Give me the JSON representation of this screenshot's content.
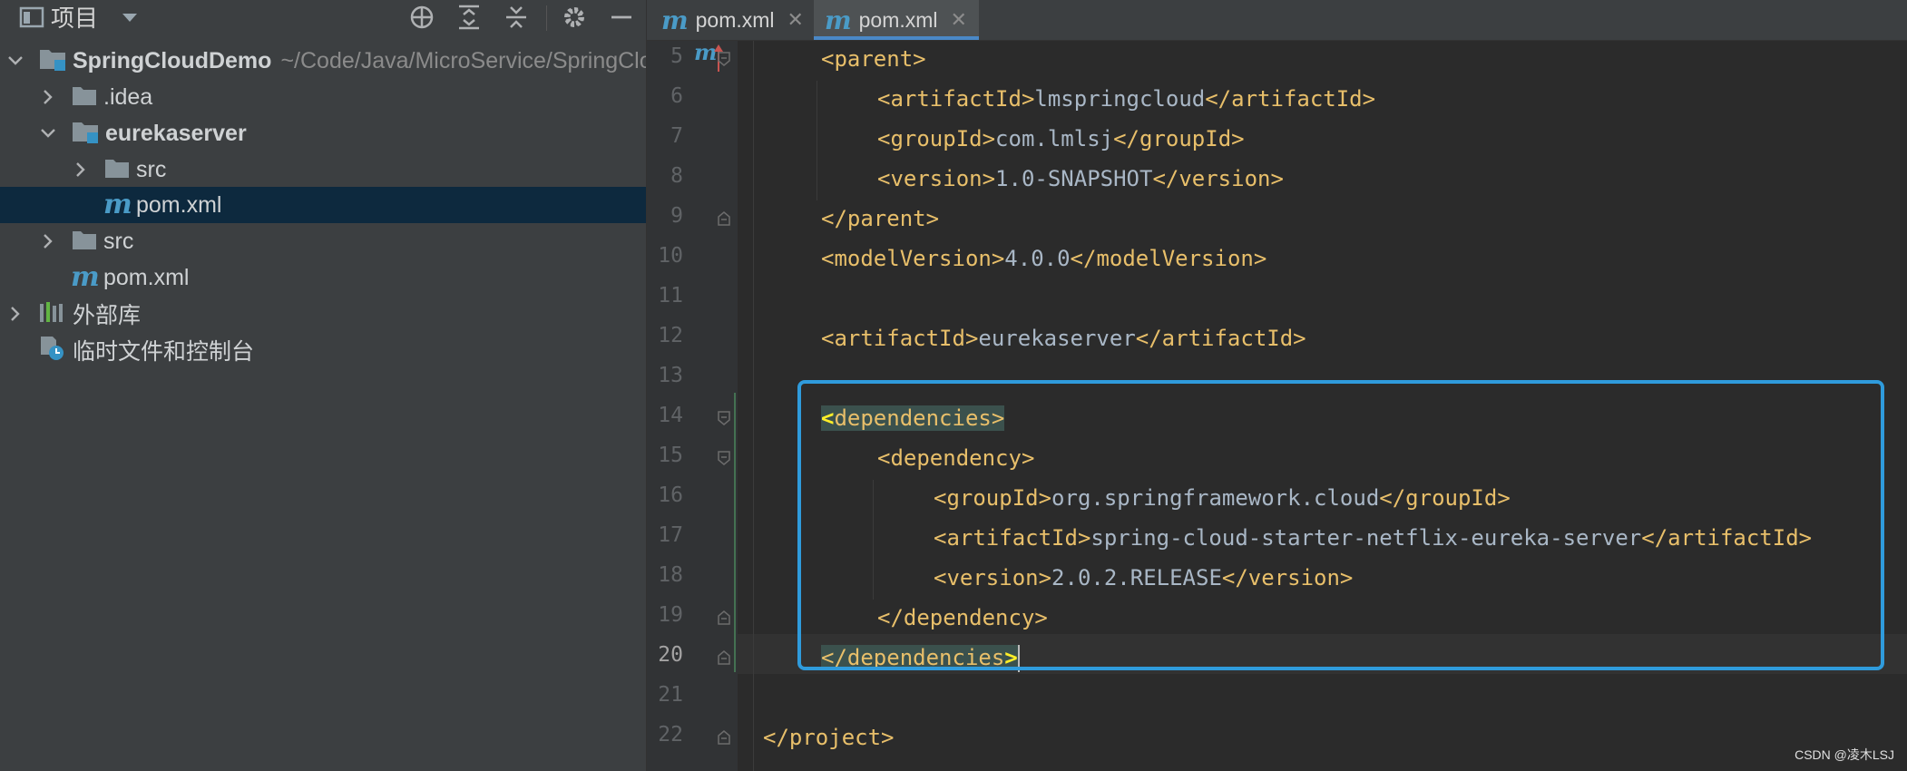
{
  "left_panel": {
    "title": "项目",
    "tree": [
      {
        "label": "SpringCloudDemo",
        "path": "~/Code/Java/MicroService/SpringCloudDemo"
      },
      {
        "label": ".idea"
      },
      {
        "label": "eurekaserver"
      },
      {
        "label": "src"
      },
      {
        "label": "pom.xml"
      },
      {
        "label": "src"
      },
      {
        "label": "pom.xml"
      },
      {
        "label": "外部库"
      },
      {
        "label": "临时文件和控制台"
      }
    ]
  },
  "tabs": [
    {
      "label": "pom.xml",
      "close": "✕"
    },
    {
      "label": "pom.xml",
      "close": "✕"
    }
  ],
  "editor": {
    "line_numbers": [
      "5",
      "6",
      "7",
      "8",
      "9",
      "10",
      "11",
      "12",
      "13",
      "14",
      "15",
      "16",
      "17",
      "18",
      "19",
      "20",
      "21",
      "22"
    ],
    "lines": {
      "l5": {
        "open": "<parent>"
      },
      "l6": {
        "open": "<artifactId>",
        "value": "lmspringcloud",
        "close": "</artifactId>"
      },
      "l7": {
        "open": "<groupId>",
        "value": "com.lmlsj",
        "close": "</groupId>"
      },
      "l8": {
        "open": "<version>",
        "value": "1.0-SNAPSHOT",
        "close": "</version>"
      },
      "l9": {
        "open": "</parent>"
      },
      "l10": {
        "open": "<modelVersion>",
        "value": "4.0.0",
        "close": "</modelVersion>"
      },
      "l12": {
        "open": "<artifactId>",
        "value": "eurekaserver",
        "close": "</artifactId>"
      },
      "l14": {
        "lt": "<",
        "rest": "dependencies>"
      },
      "l15": {
        "open": "<dependency>"
      },
      "l16": {
        "open": "<groupId>",
        "value": "org.springframework.cloud",
        "close": "</groupId>"
      },
      "l17": {
        "open": "<artifactId>",
        "value": "spring-cloud-starter-netflix-eureka-server",
        "close": "</artifactId>"
      },
      "l18": {
        "open": "<version>",
        "value": "2.0.2.RELEASE",
        "close": "</version>"
      },
      "l19": {
        "open": "</dependency>"
      },
      "l20": {
        "rest": "</dependencies",
        "gt": ">"
      },
      "l22": {
        "open": "</project>"
      }
    }
  },
  "watermark": "CSDN @凌木LSJ",
  "colors": {
    "highlight_box": "#2f9bdc",
    "tag": "#e8bf6a",
    "text": "#a9b7c6",
    "selection": "#0d293e"
  }
}
